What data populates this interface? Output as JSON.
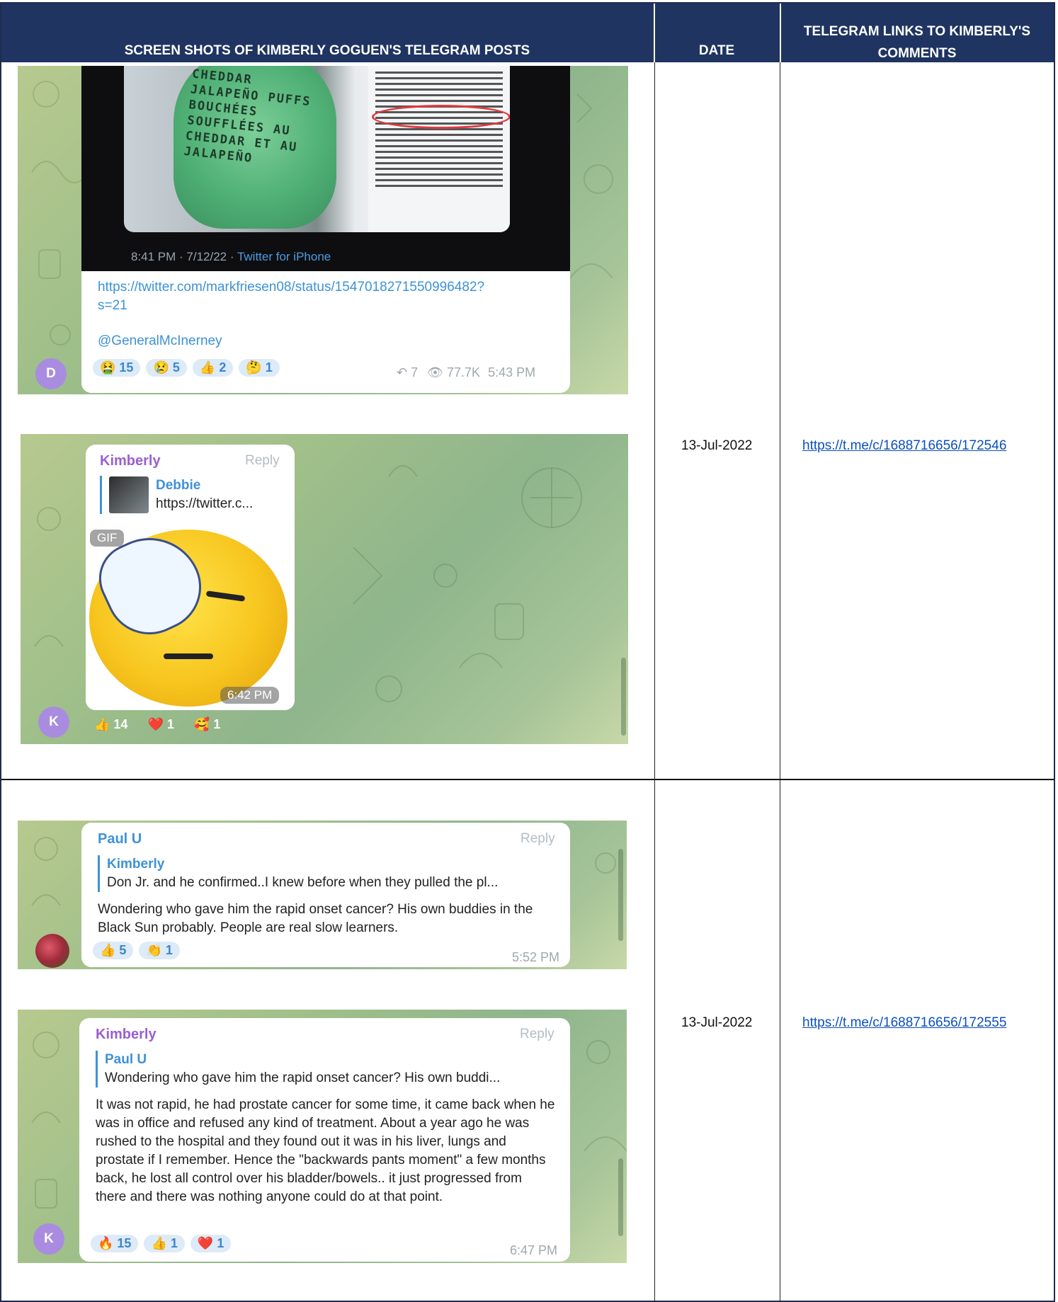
{
  "header": {
    "col1": "SCREEN SHOTS OF KIMBERLY GOGUEN'S TELEGRAM POSTS",
    "col2": "DATE",
    "col3": "TELEGRAM LINKS TO KIMBERLY'S COMMENTS"
  },
  "rows": [
    {
      "date": "13-Jul-2022",
      "link": "https://t.me/c/1688716656/172546",
      "shot1": {
        "tweet_footer": "8:41 PM · 7/12/22 ·",
        "tweet_client": "Twitter for iPhone",
        "product_text": "CHEDDAR JALAPEÑO PUFFS BOUCHÉES SOUFFLÉES AU CHEDDAR ET AU JALAPEÑO",
        "url_line1": "https://twitter.com/markfriesen08/status/1547018271550996482?",
        "url_line2": "s=21",
        "mention": "@GeneralMcInerney",
        "reactions": [
          {
            "emoji": "🤮",
            "count": "15"
          },
          {
            "emoji": "😢",
            "count": "5"
          },
          {
            "emoji": "👍",
            "count": "2"
          },
          {
            "emoji": "🤔",
            "count": "1"
          }
        ],
        "forwards": "7",
        "views": "77.7K",
        "time": "5:43 PM",
        "avatar": "D"
      },
      "shot2": {
        "name": "Kimberly",
        "reply": "Reply",
        "quote_name": "Debbie",
        "quote_text": "https://twitter.c...",
        "gif_label": "GIF",
        "time": "6:42 PM",
        "reactions": [
          {
            "emoji": "👍",
            "count": "14"
          },
          {
            "emoji": "❤️",
            "count": "1"
          },
          {
            "emoji": "🥰",
            "count": "1"
          }
        ],
        "avatar": "K"
      }
    },
    {
      "date": "13-Jul-2022",
      "link": "https://t.me/c/1688716656/172555",
      "shot1": {
        "name": "Paul U",
        "reply": "Reply",
        "quote_name": "Kimberly",
        "quote_text": "Don Jr. and he confirmed..I knew before when they pulled the pl...",
        "message": "Wondering who gave him the rapid onset cancer? His own buddies in the Black Sun probably. People are real slow learners.",
        "reactions": [
          {
            "emoji": "👍",
            "count": "5"
          },
          {
            "emoji": "👏",
            "count": "1"
          }
        ],
        "time": "5:52 PM"
      },
      "shot2": {
        "name": "Kimberly",
        "reply": "Reply",
        "quote_name": "Paul U",
        "quote_text": "Wondering who gave him the rapid onset cancer? His own buddi...",
        "message": "It was not rapid, he had prostate cancer for some time, it came back when he was in office and refused any kind of treatment. About a year ago he was rushed to the hospital and they found out it was in his liver, lungs and prostate if I remember. Hence the \"backwards pants moment\" a few months back, he lost all control over his bladder/bowels.. it just progressed from there and there was nothing anyone could do at that point.",
        "reactions": [
          {
            "emoji": "🔥",
            "count": "15"
          },
          {
            "emoji": "👍",
            "count": "1"
          },
          {
            "emoji": "❤️",
            "count": "1"
          }
        ],
        "time": "6:47 PM",
        "avatar": "K"
      }
    }
  ]
}
